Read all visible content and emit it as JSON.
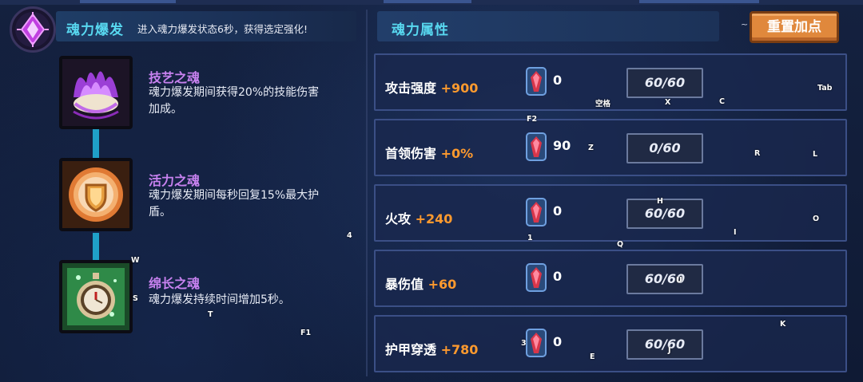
{
  "colors": {
    "accent_cyan": "#58d8f0",
    "skill_name": "#c882f0",
    "bonus_orange": "#ff9a2e",
    "reset_button": "#e0883c",
    "row_border": "#3b4f86"
  },
  "soul_burst": {
    "title": "魂力爆发",
    "description": "进入魂力爆发状态6秒，获得选定强化!",
    "emblem_icon": "soul-crystal-icon"
  },
  "skills": [
    {
      "name": "技艺之魂",
      "description": "魂力爆发期间获得20%的技能伤害加成。",
      "icon": "purple-flame-shell-icon"
    },
    {
      "name": "活力之魂",
      "description": "魂力爆发期间每秒回复15%最大护盾。",
      "icon": "golden-shield-icon"
    },
    {
      "name": "绵长之魂",
      "description": "魂力爆发持续时间增加5秒。",
      "icon": "green-stopwatch-icon"
    }
  ],
  "attributes": {
    "title": "魂力属性",
    "reset_label": "重置加点",
    "reset_hint": "~",
    "rows": [
      {
        "label": "攻击强度",
        "bonus": "+900",
        "gems": "0",
        "cap": "60/60"
      },
      {
        "label": "首领伤害",
        "bonus": "+0%",
        "gems": "90",
        "cap": "0/60"
      },
      {
        "label": "火攻",
        "bonus": "+240",
        "gems": "0",
        "cap": "60/60"
      },
      {
        "label": "暴伤值",
        "bonus": "+60",
        "gems": "0",
        "cap": "60/60"
      },
      {
        "label": "护甲穿透",
        "bonus": "+780",
        "gems": "0",
        "cap": "60/60"
      }
    ]
  },
  "key_hints": [
    "Tab",
    "空格",
    "X",
    "C",
    "F2",
    "Z",
    "R",
    "L",
    "H",
    "O",
    "I",
    "1",
    "Q",
    "4",
    "W",
    "S",
    "T",
    "F1",
    "U",
    "K",
    "3",
    "J",
    "E"
  ]
}
